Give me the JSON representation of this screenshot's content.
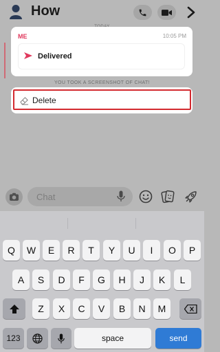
{
  "header": {
    "title": "How"
  },
  "chat": {
    "date_label": "TODAY",
    "screenshot_notice": "YOU TOOK A SCREENSHOT OF CHAT!"
  },
  "popup": {
    "sender": "ME",
    "time": "10:05 PM",
    "status": "Delivered",
    "delete_label": "Delete"
  },
  "input": {
    "placeholder": "Chat"
  },
  "keyboard": {
    "row1": [
      "Q",
      "W",
      "E",
      "R",
      "T",
      "Y",
      "U",
      "I",
      "O",
      "P"
    ],
    "row2": [
      "A",
      "S",
      "D",
      "F",
      "G",
      "H",
      "J",
      "K",
      "L"
    ],
    "row3": [
      "Z",
      "X",
      "C",
      "V",
      "B",
      "N",
      "M"
    ],
    "numbers_label": "123",
    "space_label": "space",
    "send_label": "send"
  },
  "colors": {
    "accent": "#e0395d",
    "highlight": "#d32a2f",
    "send": "#2f7bd5"
  }
}
